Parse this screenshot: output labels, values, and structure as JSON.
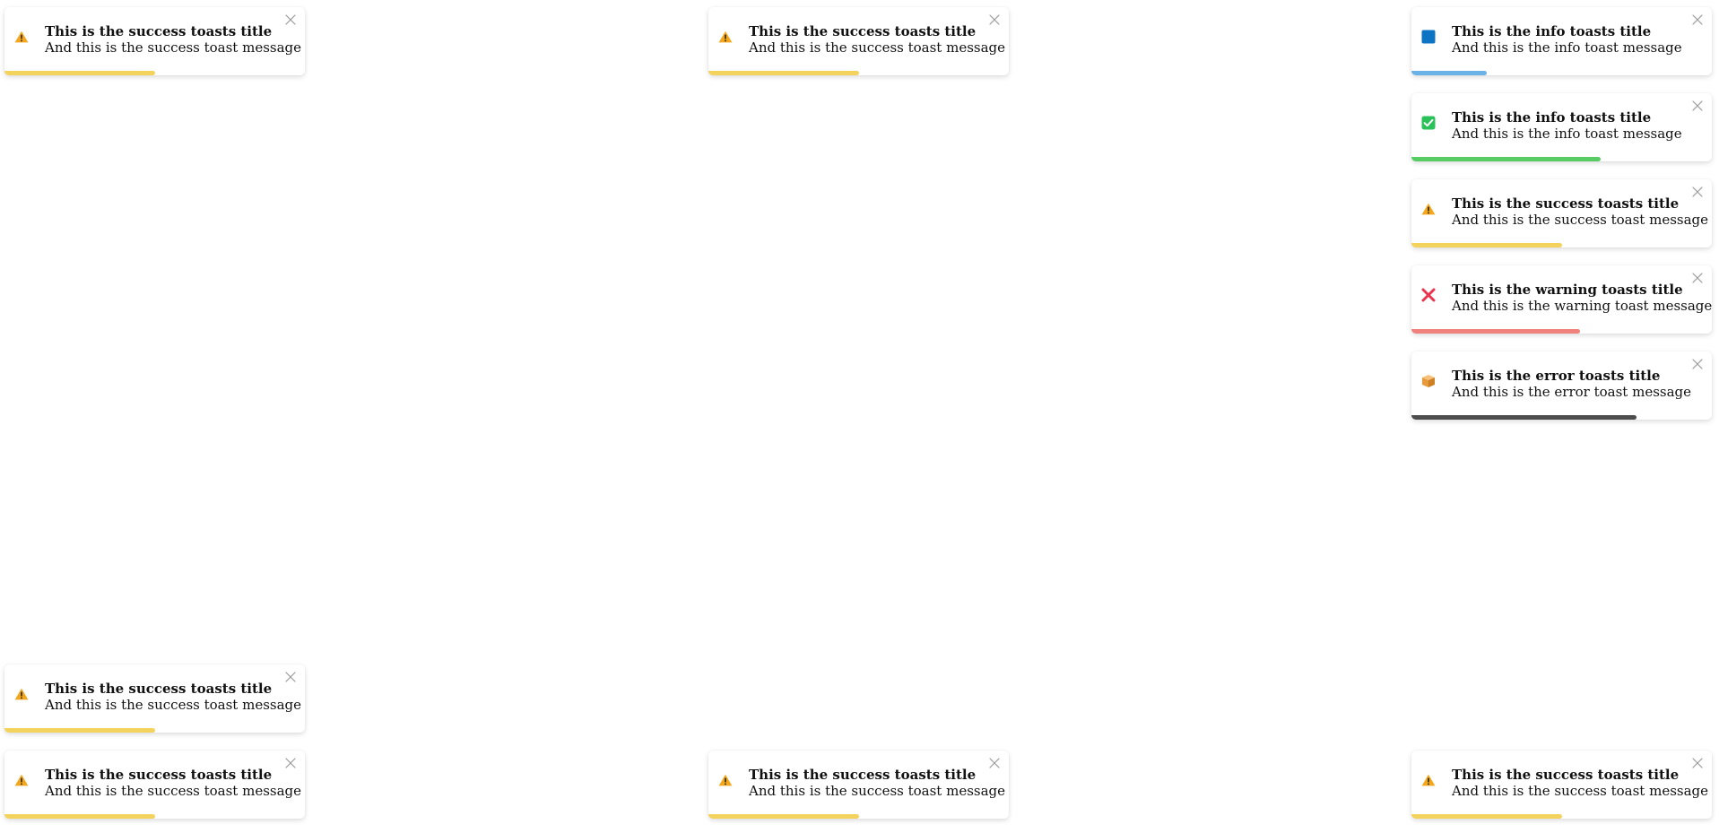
{
  "toasts": [
    {
      "title": "This is the success toasts title",
      "message": "And this is the success toast message",
      "icon": "warning-icon",
      "progress_color": "#f3d35b",
      "progress": 0.5
    },
    {
      "title": "This is the success toasts title",
      "message": "And this is the success toast message",
      "icon": "warning-icon",
      "progress_color": "#f3d35b",
      "progress": 0.5
    },
    {
      "title": "This is the info toasts title",
      "message": "And this is the info toast message",
      "icon": "blue-square-icon",
      "progress_color": "#6bb3e6",
      "progress": 0.25
    },
    {
      "title": "This is the info toasts title",
      "message": "And this is the info toast message",
      "icon": "check-box-icon",
      "progress_color": "#56cc62",
      "progress": 0.63
    },
    {
      "title": "This is the success toasts title",
      "message": "And this is the success toast message",
      "icon": "warning-icon",
      "progress_color": "#f3d35b",
      "progress": 0.5
    },
    {
      "title": "This is the warning toasts title",
      "message": "And this is the warning toast message",
      "icon": "cross-mark-icon",
      "progress_color": "#f0817c",
      "progress": 0.56
    },
    {
      "title": "This is the error toasts title",
      "message": "And this is the error toast message",
      "icon": "package-icon",
      "progress_color": "#4d4d4d",
      "progress": 0.75
    },
    {
      "title": "This is the success toasts title",
      "message": "And this is the success toast message",
      "icon": "warning-icon",
      "progress_color": "#f3d35b",
      "progress": 0.5
    },
    {
      "title": "This is the success toasts title",
      "message": "And this is the success toast message",
      "icon": "warning-icon",
      "progress_color": "#f3d35b",
      "progress": 0.5
    },
    {
      "title": "This is the success toasts title",
      "message": "And this is the success toast message",
      "icon": "warning-icon",
      "progress_color": "#f3d35b",
      "progress": 0.5
    },
    {
      "title": "This is the success toasts title",
      "message": "And this is the success toast message",
      "icon": "warning-icon",
      "progress_color": "#f3d35b",
      "progress": 0.5
    }
  ]
}
